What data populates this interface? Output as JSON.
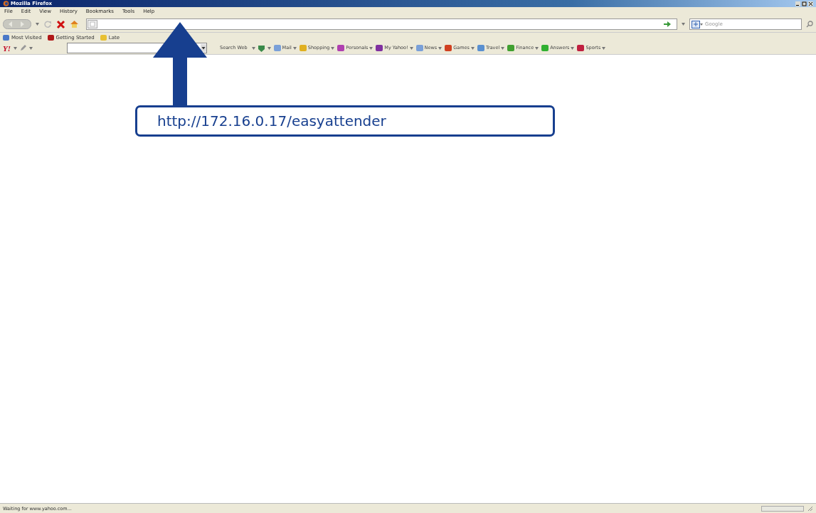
{
  "window": {
    "title": "Mozilla Firefox"
  },
  "menu": [
    "File",
    "Edit",
    "View",
    "History",
    "Bookmarks",
    "Tools",
    "Help"
  ],
  "search": {
    "placeholder": "Google"
  },
  "bookmarks": [
    {
      "label": "Most Visited",
      "color": "#4a78c8"
    },
    {
      "label": "Getting Started",
      "color": "#b01818"
    },
    {
      "label": "Late",
      "color": "#e8c030"
    }
  ],
  "toolbar": {
    "logo": "Y!",
    "search_button": "Search Web",
    "items": [
      {
        "label": "Mail",
        "color": "#7aa0d8"
      },
      {
        "label": "Shopping",
        "color": "#e0b020"
      },
      {
        "label": "Personals",
        "color": "#b040b0"
      },
      {
        "label": "My Yahoo!",
        "color": "#8030a0"
      },
      {
        "label": "News",
        "color": "#7aa0d8"
      },
      {
        "label": "Games",
        "color": "#d04020"
      },
      {
        "label": "Travel",
        "color": "#5a90d0"
      },
      {
        "label": "Finance",
        "color": "#40a030"
      },
      {
        "label": "Answers",
        "color": "#30b030"
      },
      {
        "label": "Sports",
        "color": "#c02040"
      }
    ]
  },
  "callout": {
    "text": "http://172.16.0.17/easyattender"
  },
  "status_bar": {
    "text": "Waiting for www.yahoo.com..."
  }
}
